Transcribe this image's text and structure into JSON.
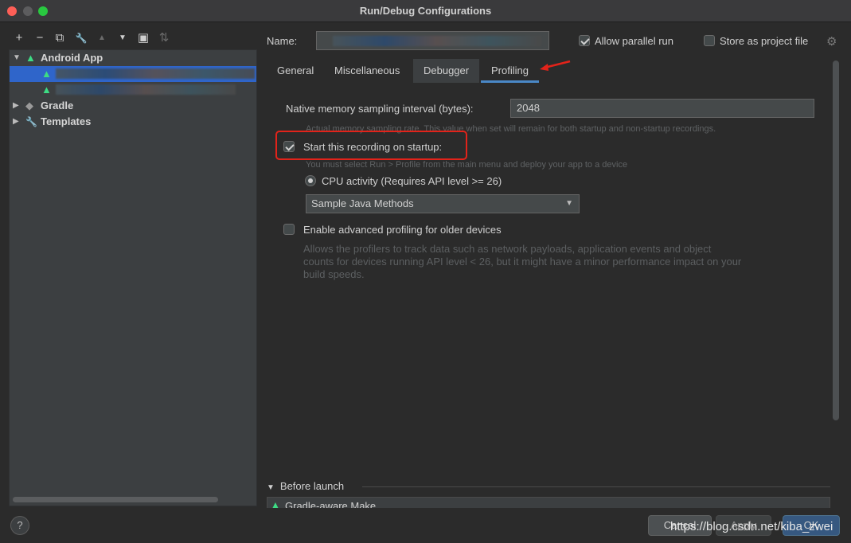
{
  "window": {
    "title": "Run/Debug Configurations"
  },
  "toolbar": {
    "icons": [
      "add-icon",
      "remove-icon",
      "copy-icon",
      "wrench-icon",
      "move-up-icon",
      "move-down-icon",
      "new-folder-icon",
      "sort-icon"
    ],
    "glyphs": [
      "+",
      "−",
      "⧉",
      "🔧",
      "▲",
      "▼",
      "▣",
      "⇅"
    ]
  },
  "tree": {
    "android_app": "Android App",
    "gradle": "Gradle",
    "templates": "Templates"
  },
  "name": {
    "label": "Name:",
    "value": ""
  },
  "options": {
    "allow_parallel_run": "Allow parallel run",
    "allow_parallel_checked": true,
    "store_as_project_file": "Store as project file",
    "store_checked": false
  },
  "tabs": [
    {
      "label": "General"
    },
    {
      "label": "Miscellaneous"
    },
    {
      "label": "Debugger"
    },
    {
      "label": "Profiling"
    }
  ],
  "active_tab": "Profiling",
  "profiling": {
    "native_memory_label": "Native memory sampling interval (bytes):",
    "native_memory_value": "2048",
    "native_hint": "Actual memory sampling rate. This value when set will remain for both startup and non-startup recordings.",
    "start_recording_label": "Start this recording on startup:",
    "start_recording_checked": true,
    "start_hint": "You must select Run > Profile from the main menu and deploy your app to a device",
    "cpu_activity_label": "CPU activity (Requires API level >= 26)",
    "method_select": "Sample Java Methods",
    "advanced_label": "Enable advanced profiling for older devices",
    "advanced_checked": false,
    "advanced_hint_1": "Allows the profilers to track data such as network payloads, application events and object",
    "advanced_hint_2": "counts for devices running API level < 26, but it might have a minor performance impact on your",
    "advanced_hint_3": "build speeds."
  },
  "before_launch": {
    "label": "Before launch",
    "item": "Gradle-aware Make"
  },
  "buttons": {
    "help": "?",
    "cancel": "Cancel",
    "apply": "Apply",
    "ok": "OK"
  },
  "watermark": "https://blog.csdn.net/kiba_zwei",
  "colors": {
    "accent": "#4a88c7",
    "selection": "#2f65ca",
    "highlight": "#e2231a",
    "android": "#3ddc84"
  }
}
